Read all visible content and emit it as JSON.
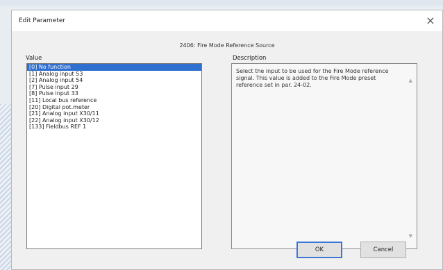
{
  "dialog": {
    "title": "Edit Parameter",
    "close_glyph": "×",
    "parameter_name": "2406: Fire Mode Reference Source",
    "value_label": "Value",
    "description_label": "Description",
    "items": [
      "[0] No function",
      "[1] Analog input 53",
      "[2] Analog input 54",
      "[7] Pulse input 29",
      "[8] Pulse input 33",
      "[11] Local bus reference",
      "[20] Digital pot.meter",
      "[21] Analog input X30/11",
      "[22] Analog input X30/12",
      "[133] Fieldbus REF 1"
    ],
    "selected_index": 0,
    "description": "Select the input to be used for the Fire Mode reference signal. This value is added to the Fire Mode preset reference set in par. 24-02.",
    "ok_label": "OK",
    "cancel_label": "Cancel",
    "icons": {
      "close": "close-icon",
      "scroll_up": "scroll-up-icon",
      "scroll_down": "scroll-down-icon"
    },
    "colors": {
      "selection": "#2f6fd0",
      "default_button_border": "#3b78d6"
    }
  }
}
